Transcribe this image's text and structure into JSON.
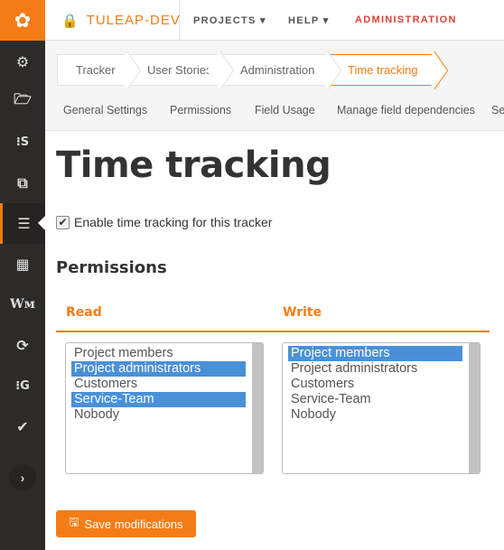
{
  "brand": {
    "name": "TULEAP-DEV"
  },
  "topnav": {
    "projects": "PROJECTS ▾",
    "help": "HELP ▾",
    "administration": "ADMINISTRATION"
  },
  "breadcrumbs": [
    "Trackers",
    "User Stories",
    "Administration",
    "Time tracking"
  ],
  "tabs": [
    "General Settings",
    "Permissions",
    "Field Usage",
    "Manage field dependencies",
    "Se"
  ],
  "page": {
    "title": "Time tracking",
    "enable_label": "Enable time tracking for this tracker",
    "enable_checked": true,
    "permissions_heading": "Permissions",
    "read_label": "Read",
    "write_label": "Write",
    "save_label": "Save modifications"
  },
  "read_options": [
    {
      "label": "Project members",
      "selected": false
    },
    {
      "label": "Project administrators",
      "selected": true
    },
    {
      "label": "Customers",
      "selected": false
    },
    {
      "label": "Service-Team",
      "selected": true
    },
    {
      "label": "Nobody",
      "selected": false
    }
  ],
  "write_options": [
    {
      "label": "Project members",
      "selected": true
    },
    {
      "label": "Project administrators",
      "selected": false
    },
    {
      "label": "Customers",
      "selected": false
    },
    {
      "label": "Service-Team",
      "selected": false
    },
    {
      "label": "Nobody",
      "selected": false
    }
  ],
  "sidebar_icons": [
    "gears-icon",
    "folder-open-icon",
    "git-icon",
    "documents-icon",
    "tracker-list-icon",
    "table-icon",
    "wiki-icon",
    "refresh-icon",
    "gitlab-icon",
    "check-icon"
  ],
  "colors": {
    "accent": "#f47c16",
    "sidebar": "#2c2b29",
    "selected": "#4a90d9",
    "admin": "#d9443c"
  }
}
